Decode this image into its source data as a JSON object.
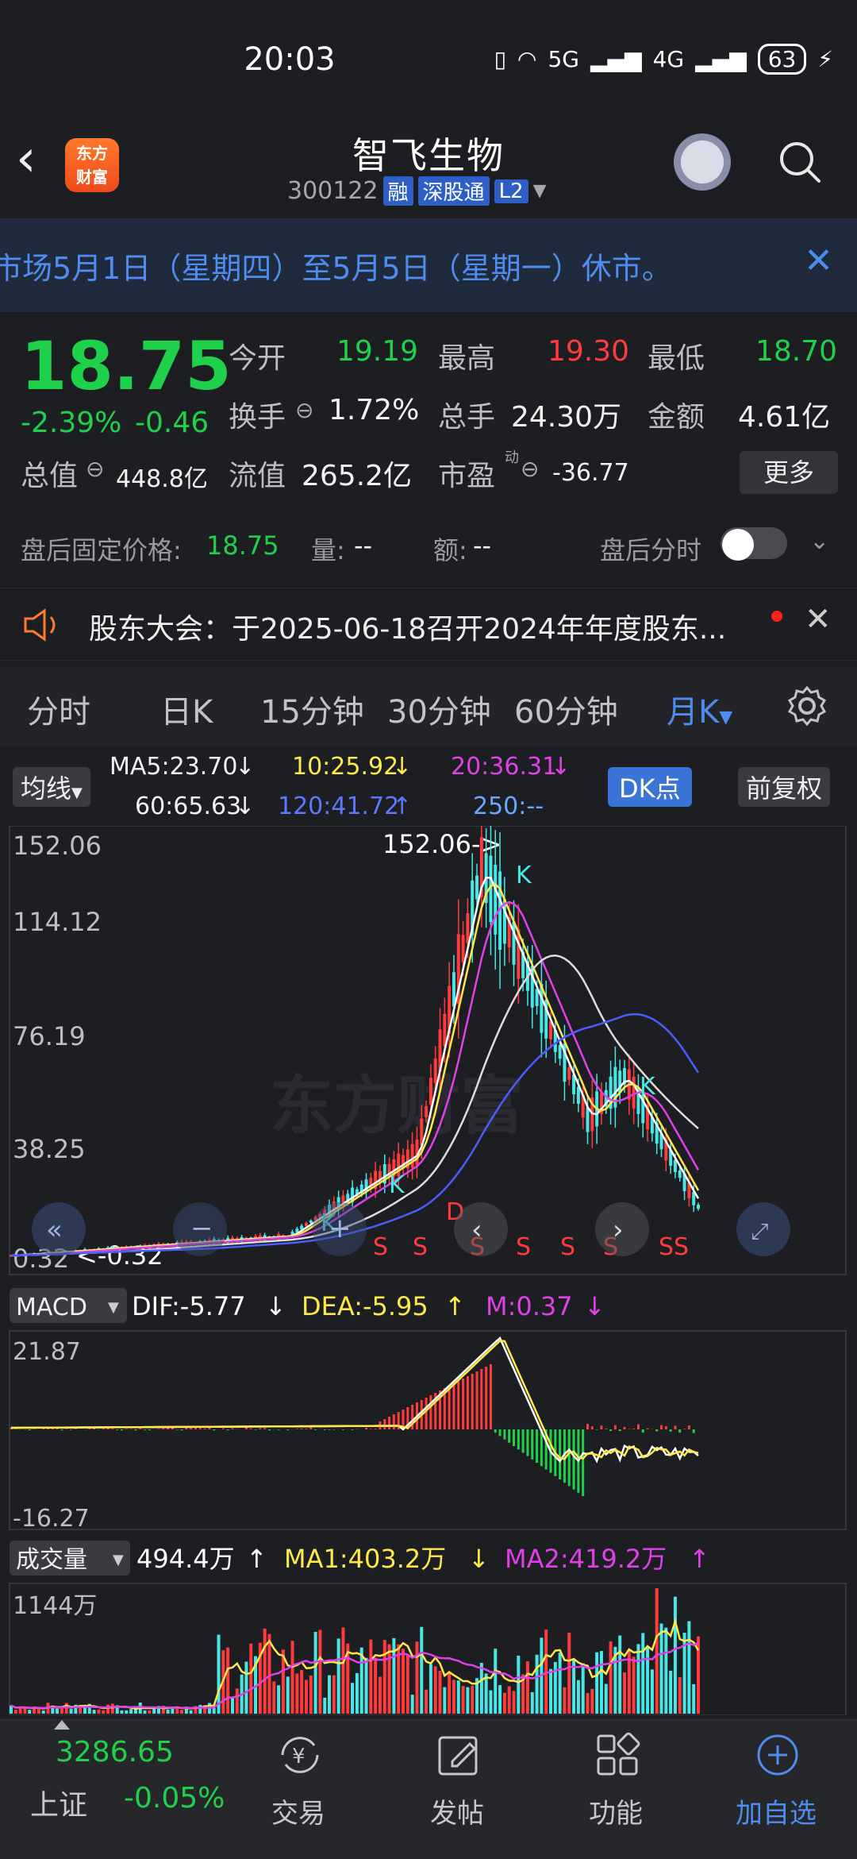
{
  "status_bar": {
    "time": "20:03",
    "network": "5G",
    "network2": "4G",
    "battery": "63"
  },
  "header": {
    "logo_line1": "东方",
    "logo_line2": "财富",
    "title": "智飞生物",
    "code": "300122",
    "tags": [
      "融",
      "深股通",
      "L2"
    ]
  },
  "notice": {
    "text": "市场5月1日（星期四）至5月5日（星期一）休市。"
  },
  "quote": {
    "price": "18.75",
    "change_pct": "-2.39%",
    "change": "-0.46",
    "open_label": "今开",
    "open": "19.19",
    "high_label": "最高",
    "high": "19.30",
    "low_label": "最低",
    "low": "18.70",
    "turnover_label": "换手",
    "turnover": "1.72%",
    "volume_label": "总手",
    "volume": "24.30万",
    "amount_label": "金额",
    "amount": "4.61亿",
    "mktcap_label": "总值",
    "mktcap": "448.8亿",
    "float_label": "流值",
    "float_cap": "265.2亿",
    "pe_label": "市盈",
    "pe_sup": "动",
    "pe": "-36.77",
    "more": "更多"
  },
  "after_hours": {
    "fixed_label": "盘后固定价格:",
    "fixed_value": "18.75",
    "vol_label": "量:",
    "vol_value": "--",
    "amt_label": "额:",
    "amt_value": "--",
    "ts_label": "盘后分时"
  },
  "meeting": {
    "text": "股东大会：于2025-06-18召开2024年年度股东..."
  },
  "tabs": [
    "分时",
    "日K",
    "15分钟",
    "30分钟",
    "60分钟",
    "月K"
  ],
  "ma_legend": {
    "selector": "均线",
    "ma5": "MA5:23.70",
    "ma10": "10:25.92",
    "ma20": "20:36.31",
    "ma60": "60:65.63",
    "ma120": "120:41.72",
    "ma250": "250:--",
    "dk": "DK点",
    "fq": "前复权"
  },
  "kline": {
    "y_labels": [
      "152.06",
      "114.12",
      "76.19",
      "38.25",
      "0.32"
    ],
    "max_label": "152.06->",
    "min_label": "<-0.32",
    "watermark": "东方财富",
    "colors": {
      "up": "#ff3b3b",
      "down": "#49e6e6",
      "ma5": "#ffffff",
      "ma10": "#ffe84a",
      "ma20": "#e040e8",
      "ma60": "#dddddd",
      "ma120": "#4b5cff"
    }
  },
  "macd": {
    "selector": "MACD",
    "dif": "DIF:-5.77",
    "dea": "DEA:-5.95",
    "m": "M:0.37",
    "y_top": "21.87",
    "y_bottom": "-16.27"
  },
  "volume": {
    "selector": "成交量",
    "vol": "494.4万",
    "ma1": "MA1:403.2万",
    "ma2": "MA2:419.2万",
    "y_top": "1144万"
  },
  "bottom_nav": {
    "index_value": "3286.65",
    "index_name": "上证",
    "index_change": "-0.05%",
    "items": [
      "交易",
      "发帖",
      "功能",
      "加自选"
    ]
  }
}
